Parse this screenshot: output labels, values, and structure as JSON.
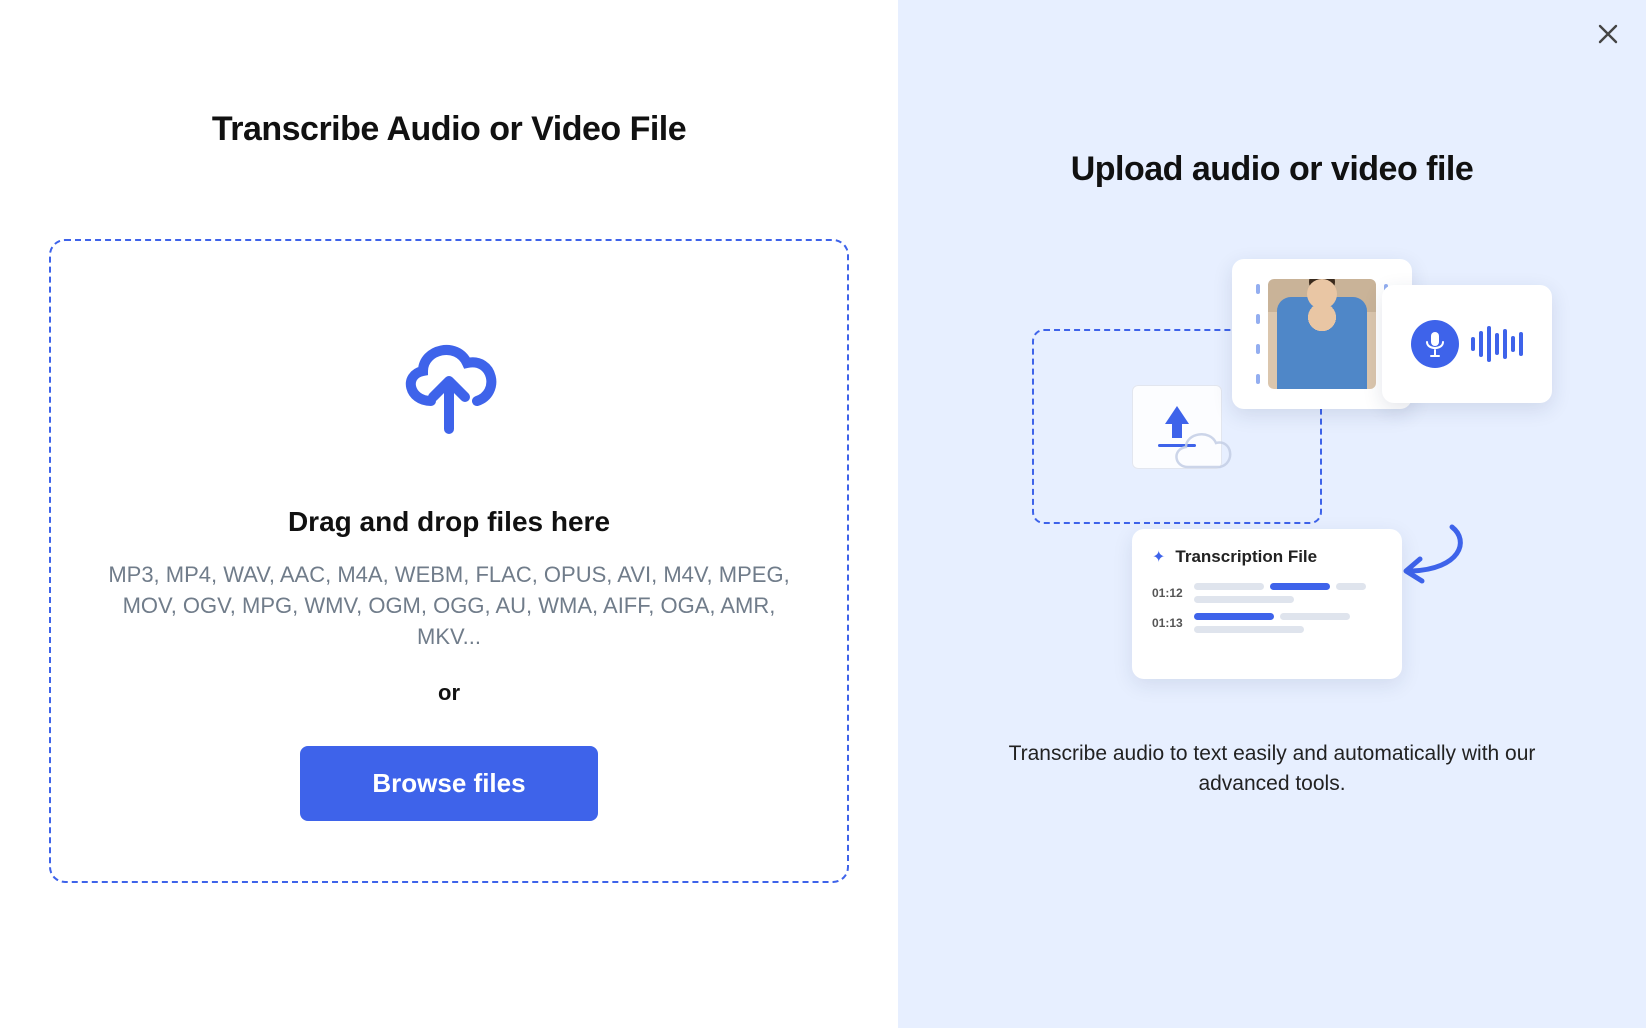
{
  "left": {
    "title": "Transcribe Audio or Video File",
    "dropzone": {
      "heading": "Drag and drop files here",
      "formats": "MP3, MP4, WAV, AAC, M4A, WEBM, FLAC, OPUS, AVI, M4V, MPEG, MOV, OGV, MPG, WMV, OGM, OGG, AU, WMA, AIFF, OGA, AMR, MKV...",
      "or": "or",
      "browse_label": "Browse files"
    }
  },
  "right": {
    "title": "Upload audio or video file",
    "transcription_label": "Transcription File",
    "timestamp1": "01:12",
    "timestamp2": "01:13",
    "description": "Transcribe audio to text easily and automatically with our advanced tools."
  }
}
